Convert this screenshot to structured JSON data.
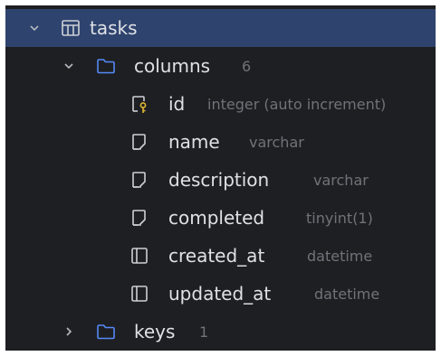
{
  "tree": {
    "table": {
      "name": "tasks",
      "icon": "table-icon",
      "expanded": true,
      "selected": true
    },
    "columns_folder": {
      "label": "columns",
      "count": "6",
      "icon": "folder-icon",
      "expanded": true
    },
    "columns": [
      {
        "name": "id",
        "type": "integer (auto increment)",
        "icon": "primary-key-column-icon"
      },
      {
        "name": "name",
        "type": "varchar",
        "icon": "column-icon"
      },
      {
        "name": "description",
        "type": "varchar",
        "icon": "column-icon"
      },
      {
        "name": "completed",
        "type": "tinyint(1)",
        "icon": "column-icon"
      },
      {
        "name": "created_at",
        "type": "datetime",
        "icon": "column-box-icon"
      },
      {
        "name": "updated_at",
        "type": "datetime",
        "icon": "column-box-icon"
      }
    ],
    "keys_folder": {
      "label": "keys",
      "count": "1",
      "icon": "folder-icon",
      "expanded": false
    }
  },
  "colors": {
    "background": "#1e1f22",
    "selection": "#2e436e",
    "text": "#dfe1e5",
    "muted": "#6f737a",
    "folder_icon": "#548af7",
    "key_icon": "#e0b533"
  }
}
